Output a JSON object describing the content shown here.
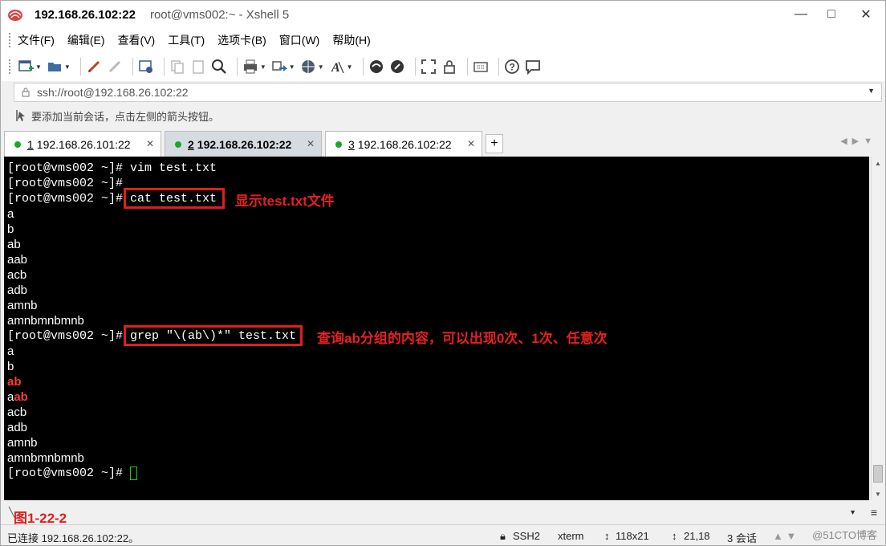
{
  "window": {
    "title_main": "192.168.26.102:22",
    "title_sub": "root@vms002:~ - Xshell 5",
    "buttons": {
      "minimize": "—",
      "maximize": "□",
      "close": "✕"
    }
  },
  "menu": [
    "文件(F)",
    "编辑(E)",
    "查看(V)",
    "工具(T)",
    "选项卡(B)",
    "窗口(W)",
    "帮助(H)"
  ],
  "address": {
    "value": "ssh://root@192.168.26.102:22"
  },
  "hint": "要添加当前会话，点击左侧的箭头按钮。",
  "tabs": [
    {
      "num": "1",
      "label": "192.168.26.101:22",
      "active": false
    },
    {
      "num": "2",
      "label": "192.168.26.102:22",
      "active": true
    },
    {
      "num": "3",
      "label": "192.168.26.102:22",
      "active": false
    }
  ],
  "tab_add": "+",
  "terminal": {
    "prompt": "[root@vms002 ~]# ",
    "cmd1": "vim test.txt",
    "cmd2": "cat test.txt",
    "cmd3": "grep \"\\(ab\\)*\" test.txt",
    "cat_output": [
      "a",
      "b",
      "ab",
      "aab",
      "acb",
      "adb",
      "amnb",
      "amnbmnbmnb"
    ],
    "grep_output": {
      "l1": "a",
      "l2": "b",
      "l3": "ab",
      "l4_prefix": "a",
      "l4_match": "ab",
      "l5": "acb",
      "l6": "adb",
      "l7": "amnb",
      "l8": "amnbmnbmnb"
    }
  },
  "annotations": {
    "note1": "显示test.txt文件",
    "note2": "查询ab分组的内容，可以出现0次、1次、任意次"
  },
  "figure_label": "图1-22-2",
  "status": {
    "connected": "已连接 192.168.26.102:22。",
    "protocol": "SSH2",
    "term": "xterm",
    "size": "118x21",
    "pos": "21,18",
    "sessions": "3 会话"
  },
  "watermark": "@51CTO博客",
  "colors": {
    "annotation": "#e01e1e",
    "terminal_bg": "#000000",
    "match": "#ff3b3b",
    "online_dot": "#18a82e"
  }
}
